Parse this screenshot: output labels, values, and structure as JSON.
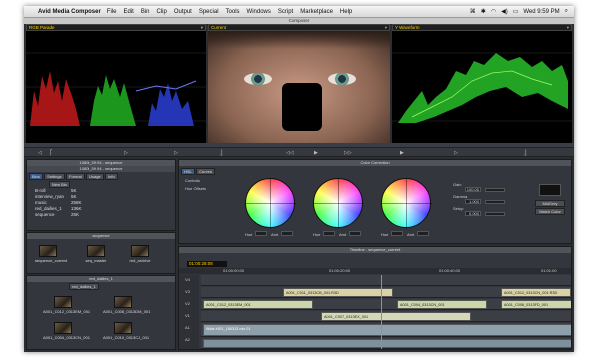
{
  "menubar": {
    "app_name": "Avid Media Composer",
    "items": [
      "File",
      "Edit",
      "Bin",
      "Clip",
      "Output",
      "Special",
      "Tools",
      "Windows",
      "Script",
      "Marketplace",
      "Help"
    ],
    "clock": "Wed 9:59 PM"
  },
  "composer": {
    "title": "Composer",
    "left_monitor": "RGB Parade",
    "center_monitor": "Current",
    "right_monitor": "Y Waveform"
  },
  "project": {
    "title": "1080i_59.94 - sequence",
    "subtitle": "1080i_59.94 - sequence",
    "tabs": [
      "Bins",
      "Settings",
      "Format",
      "Usage",
      "Info"
    ],
    "new_bin": "New Bin",
    "bins": [
      {
        "name": "B-roll",
        "size": "5K"
      },
      {
        "name": "interview_ryan",
        "size": "5K"
      },
      {
        "name": "music",
        "size": "258K"
      },
      {
        "name": "red_dailies_1",
        "size": "136K"
      },
      {
        "name": "sequence",
        "size": "25K"
      }
    ]
  },
  "sequence_bin": {
    "title": "sequence",
    "clips": [
      "sequence_current",
      "seq_master",
      "red_archive"
    ]
  },
  "dailies_bin": {
    "title": "red_dailies_1",
    "tab": "red_dailies_1",
    "clips": [
      "A001_C012_0313EM_001",
      "A001_C008_0313DM_001",
      "A001_C004_0313CN_001",
      "A001_C010_0313CJ_001"
    ]
  },
  "color_correction": {
    "title": "Color Correction",
    "tabs": [
      "HSL",
      "Curves"
    ],
    "options": [
      "Controls",
      "Hue Offsets"
    ],
    "wheel_labels": [
      "Shadows",
      "Midtones",
      "Highlights"
    ],
    "value_labels": [
      "Hue",
      "Amt"
    ],
    "gain_label": "Gain",
    "gamma_label": "Gamma",
    "setup_label": "Setup",
    "gain_value": "100.00",
    "gamma_value": "1.000",
    "setup_value": "0.000",
    "mode": "MidGrey",
    "match_label": "Match Color"
  },
  "timeline": {
    "title": "Timeline - sequence_current",
    "timecode": "01:00:28:08",
    "ruler": [
      "01:00:00:00",
      "01:00:20:00",
      "01:00:40:00",
      "01:01:00"
    ],
    "tracks": [
      "V4",
      "V3",
      "V2",
      "V1",
      "A1",
      "A2"
    ],
    "clips_v2": [
      "A001_C011_0313CB_001.R3D",
      "A001_C012_0313CN_001.R3D"
    ],
    "clips_v1": [
      "A001_C012_0313EM_001",
      "A001_C004_0313CN_001",
      "A001_C006_0313FD_001",
      "A001_C007_0313EX_001"
    ],
    "audio_clip": "Wide-HD1_180313 mix 01"
  }
}
